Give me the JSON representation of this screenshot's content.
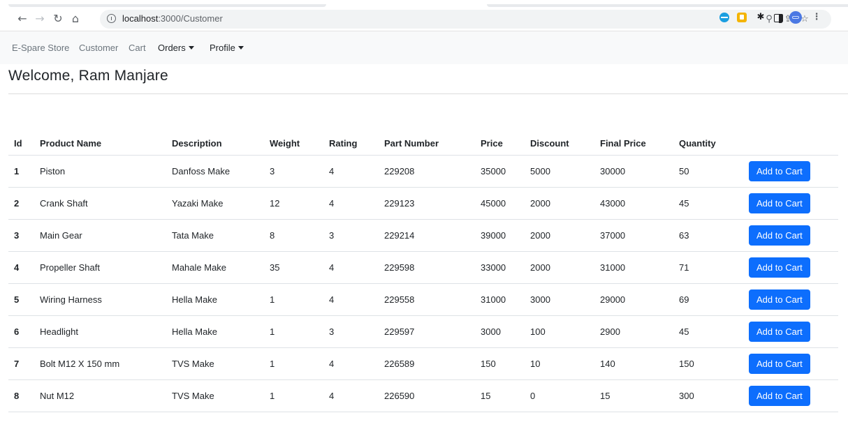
{
  "browser": {
    "url_host": "localhost",
    "url_path": ":3000/Customer",
    "icons": [
      "back-icon",
      "forward-icon",
      "reload-icon",
      "home-icon",
      "info-icon",
      "zoom-icon",
      "share-icon",
      "star-icon",
      "extension-icon",
      "puzzle-icon",
      "side-panel-icon",
      "profile-avatar",
      "more-menu-icon"
    ]
  },
  "navbar": {
    "brand": "E-Spare Store",
    "links": [
      "Customer",
      "Cart"
    ],
    "orders": "Orders",
    "profile": "Profile"
  },
  "page": {
    "welcome": "Welcome, Ram Manjare"
  },
  "table": {
    "headers": [
      "Id",
      "Product Name",
      "Description",
      "Weight",
      "Rating",
      "Part Number",
      "Price",
      "Discount",
      "Final Price",
      "Quantity"
    ],
    "button_label": "Add to Cart",
    "rows": [
      [
        "1",
        "Piston",
        "Danfoss Make",
        "3",
        "4",
        "229208",
        "35000",
        "5000",
        "30000",
        "50"
      ],
      [
        "2",
        "Crank Shaft",
        "Yazaki Make",
        "12",
        "4",
        "229123",
        "45000",
        "2000",
        "43000",
        "45"
      ],
      [
        "3",
        "Main Gear",
        "Tata Make",
        "8",
        "3",
        "229214",
        "39000",
        "2000",
        "37000",
        "63"
      ],
      [
        "4",
        "Propeller Shaft",
        "Mahale Make",
        "35",
        "4",
        "229598",
        "33000",
        "2000",
        "31000",
        "71"
      ],
      [
        "5",
        "Wiring Harness",
        "Hella Make",
        "1",
        "4",
        "229558",
        "31000",
        "3000",
        "29000",
        "69"
      ],
      [
        "6",
        "Headlight",
        "Hella Make",
        "1",
        "3",
        "229597",
        "3000",
        "100",
        "2900",
        "45"
      ],
      [
        "7",
        "Bolt M12 X 150 mm",
        "TVS Make",
        "1",
        "4",
        "226589",
        "150",
        "10",
        "140",
        "150"
      ],
      [
        "8",
        "Nut M12",
        "TVS Make",
        "1",
        "4",
        "226590",
        "15",
        "0",
        "15",
        "300"
      ]
    ]
  },
  "colors": {
    "primary": "#0d6efd",
    "navbar_bg": "#f8f9fa",
    "muted": "#6c757d"
  }
}
